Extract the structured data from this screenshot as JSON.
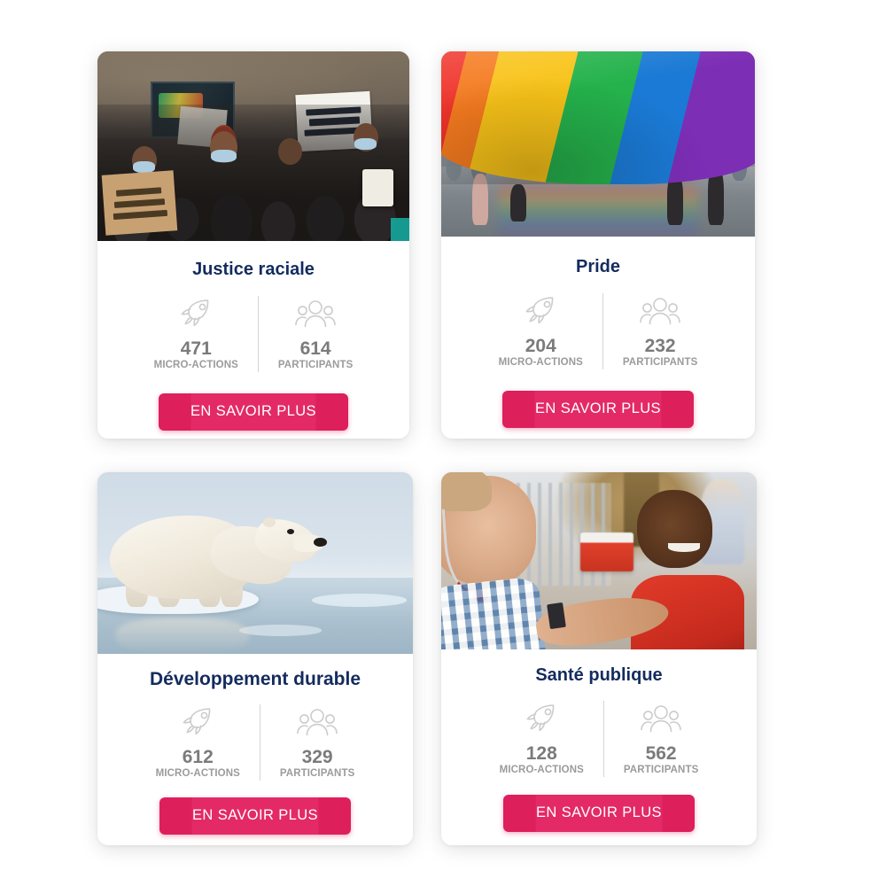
{
  "theme": {
    "page_background": "#ffffff",
    "card_background": "#ffffff",
    "title_color": "#142b5e",
    "stat_value_color": "#7b7b7b",
    "stat_label_color": "#9b9b9b",
    "icon_color": "#cccccc",
    "cta_color": "#e0225e",
    "cta_text_color": "#ffffff"
  },
  "cards": [
    {
      "id": "justice-raciale",
      "title": "Justice raciale",
      "image_alt": "Manifestation Black Lives Matter",
      "stats": [
        {
          "icon": "rocket-icon",
          "value": "471",
          "label": "MICRO-ACTIONS"
        },
        {
          "icon": "people-icon",
          "value": "614",
          "label": "PARTICIPANTS"
        }
      ],
      "cta_label": "EN SAVOIR PLUS"
    },
    {
      "id": "pride",
      "title": "Pride",
      "image_alt": "Drapeau arc-en-ciel porte lors d une marche des fiertes",
      "stats": [
        {
          "icon": "rocket-icon",
          "value": "204",
          "label": "MICRO-ACTIONS"
        },
        {
          "icon": "people-icon",
          "value": "232",
          "label": "PARTICIPANTS"
        }
      ],
      "cta_label": "EN SAVOIR PLUS"
    },
    {
      "id": "developpement-durable",
      "title": "Développement durable",
      "image_alt": "Ours polaire sur la banquise",
      "stats": [
        {
          "icon": "rocket-icon",
          "value": "612",
          "label": "MICRO-ACTIONS"
        },
        {
          "icon": "people-icon",
          "value": "329",
          "label": "PARTICIPANTS"
        }
      ],
      "cta_label": "EN SAVOIR PLUS"
    },
    {
      "id": "sante-publique",
      "title": "Santé publique",
      "image_alt": "Medecin avec stethoscope et enfant souriant",
      "stats": [
        {
          "icon": "rocket-icon",
          "value": "128",
          "label": "MICRO-ACTIONS"
        },
        {
          "icon": "people-icon",
          "value": "562",
          "label": "PARTICIPANTS"
        }
      ],
      "cta_label": "EN SAVOIR PLUS"
    }
  ]
}
